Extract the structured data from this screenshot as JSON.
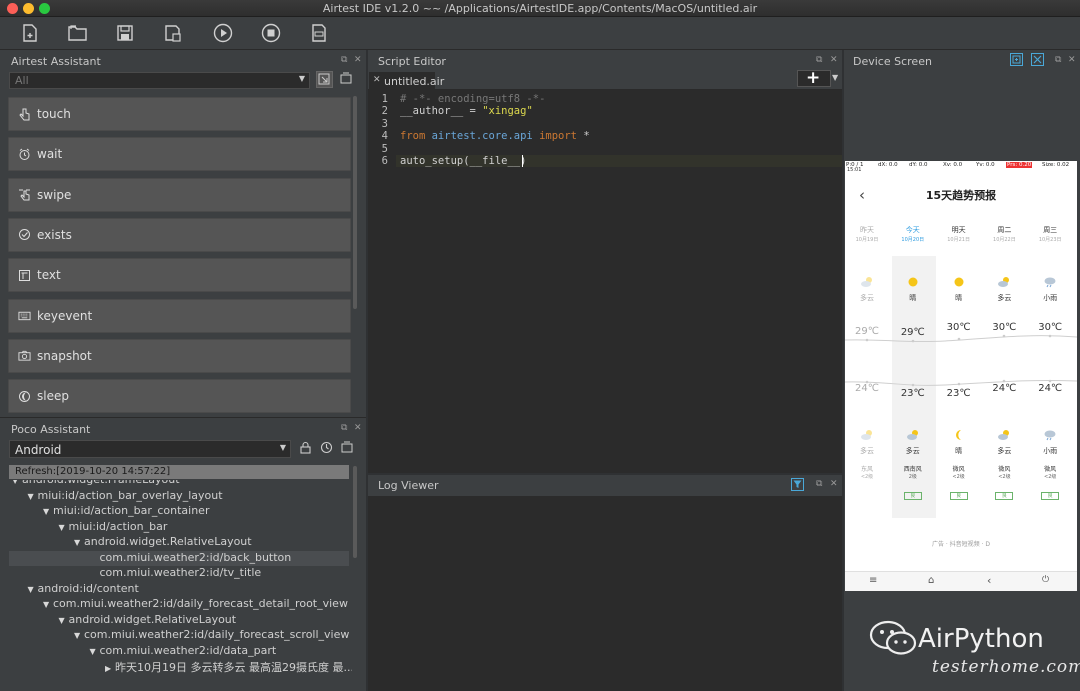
{
  "window": {
    "title": "Airtest IDE v1.2.0 ~~ /Applications/AirtestIDE.app/Contents/MacOS/untitled.air"
  },
  "colors": {
    "panel_bg": "#3c3f41",
    "editor_bg": "#2b2b2b",
    "button_bg": "#555555",
    "accent": "#2e7fb8",
    "tree_selected": "#4a4d50"
  },
  "airtest_assistant": {
    "title": "Airtest Assistant",
    "filter_value": "All",
    "buttons": [
      {
        "label": "touch",
        "icon": "hand-pointer-icon"
      },
      {
        "label": "wait",
        "icon": "alarm-clock-icon"
      },
      {
        "label": "swipe",
        "icon": "swipe-hand-icon"
      },
      {
        "label": "exists",
        "icon": "check-circle-icon"
      },
      {
        "label": "text",
        "icon": "text-box-icon"
      },
      {
        "label": "keyevent",
        "icon": "keyboard-icon"
      },
      {
        "label": "snapshot",
        "icon": "camera-icon"
      },
      {
        "label": "sleep",
        "icon": "moon-icon"
      }
    ]
  },
  "poco_assistant": {
    "title": "Poco Assistant",
    "platform": "Android",
    "refresh": "Refresh:[2019-10-20 14:57:22]",
    "tree": [
      {
        "label": "android.widget.FrameLayout",
        "depth": 0,
        "arrow": "▼"
      },
      {
        "label": "miui:id/action_bar_overlay_layout",
        "depth": 1,
        "arrow": "▼"
      },
      {
        "label": "miui:id/action_bar_container",
        "depth": 2,
        "arrow": "▼"
      },
      {
        "label": "miui:id/action_bar",
        "depth": 3,
        "arrow": "▼"
      },
      {
        "label": "android.widget.RelativeLayout",
        "depth": 4,
        "arrow": "▼"
      },
      {
        "label": "com.miui.weather2:id/back_button",
        "depth": 5,
        "arrow": "",
        "selected": true
      },
      {
        "label": "com.miui.weather2:id/tv_title",
        "depth": 5,
        "arrow": ""
      },
      {
        "label": "android:id/content",
        "depth": 1,
        "arrow": "▼"
      },
      {
        "label": "com.miui.weather2:id/daily_forecast_detail_root_view",
        "depth": 2,
        "arrow": "▼"
      },
      {
        "label": "android.widget.RelativeLayout",
        "depth": 3,
        "arrow": "▼"
      },
      {
        "label": "com.miui.weather2:id/daily_forecast_scroll_view",
        "depth": 4,
        "arrow": "▼"
      },
      {
        "label": "com.miui.weather2:id/data_part",
        "depth": 5,
        "arrow": "▼"
      },
      {
        "label": "昨天10月19日 多云转多云 最高温29摄氏度 最...",
        "depth": 6,
        "arrow": "▶"
      }
    ]
  },
  "script_editor": {
    "title": "Script Editor",
    "tab": "untitled.air",
    "lines": [
      {
        "n": "1",
        "parts": [
          [
            "c-com",
            "# -*- encoding=utf8 -*-"
          ]
        ]
      },
      {
        "n": "2",
        "parts": [
          [
            "c-def",
            "__author__ = "
          ],
          [
            "c-str",
            "\"xingag\""
          ]
        ]
      },
      {
        "n": "3",
        "parts": []
      },
      {
        "n": "4",
        "parts": [
          [
            "c-kw",
            "from "
          ],
          [
            "c-mod",
            "airtest.core.api "
          ],
          [
            "c-kw",
            "import "
          ],
          [
            "c-def",
            "*"
          ]
        ]
      },
      {
        "n": "5",
        "parts": []
      },
      {
        "n": "6",
        "parts": [
          [
            "c-def",
            "auto_setup(__file__)"
          ]
        ]
      }
    ]
  },
  "log_viewer": {
    "title": "Log Viewer"
  },
  "device_screen": {
    "title": "Device Screen",
    "status_bar": {
      "p": "P:0 / 1",
      "dx": "dX: 0.0",
      "dy": "dY: 0.0",
      "xv": "Xv: 0.0",
      "yv": "Yv: 0.0",
      "prs": "Prs: 0.20",
      "size": "Size: 0.02",
      "time": "15:01"
    },
    "phone": {
      "header": "15天趋势预报",
      "days": [
        {
          "name": "昨天",
          "date": "10月19日",
          "weather": "多云",
          "high": "29℃",
          "low": "24℃",
          "night": "多云",
          "wind": "东风",
          "level": "<2级",
          "icon": "cloud-sun-icon",
          "nicon": "cloud-sun-icon",
          "dim": true
        },
        {
          "name": "今天",
          "date": "10月20日",
          "weather": "晴",
          "high": "29℃",
          "low": "23℃",
          "night": "多云",
          "wind": "西南风",
          "level": "2级",
          "icon": "sun-icon",
          "nicon": "cloud-moon-icon",
          "dim": false,
          "today": true,
          "aq": "良"
        },
        {
          "name": "明天",
          "date": "10月21日",
          "weather": "晴",
          "high": "30℃",
          "low": "23℃",
          "night": "晴",
          "wind": "微风",
          "level": "<2级",
          "icon": "sun-icon",
          "nicon": "moon-icon",
          "dim": false,
          "aq": "良"
        },
        {
          "name": "周二",
          "date": "10月22日",
          "weather": "多云",
          "high": "30℃",
          "low": "24℃",
          "night": "多云",
          "wind": "微风",
          "level": "<2级",
          "icon": "cloud-sun-icon",
          "nicon": "cloud-moon-icon",
          "dim": false,
          "aq": "良"
        },
        {
          "name": "周三",
          "date": "10月23日",
          "weather": "小雨",
          "high": "30℃",
          "low": "24℃",
          "night": "小雨",
          "wind": "微风",
          "level": "<2级",
          "icon": "rain-icon",
          "nicon": "rain-icon",
          "dim": false,
          "aq": "良"
        }
      ],
      "ad": "广告 · 抖音短视频 · D"
    }
  },
  "watermark": {
    "brand": "AirPython",
    "site": "testerhome.com"
  }
}
